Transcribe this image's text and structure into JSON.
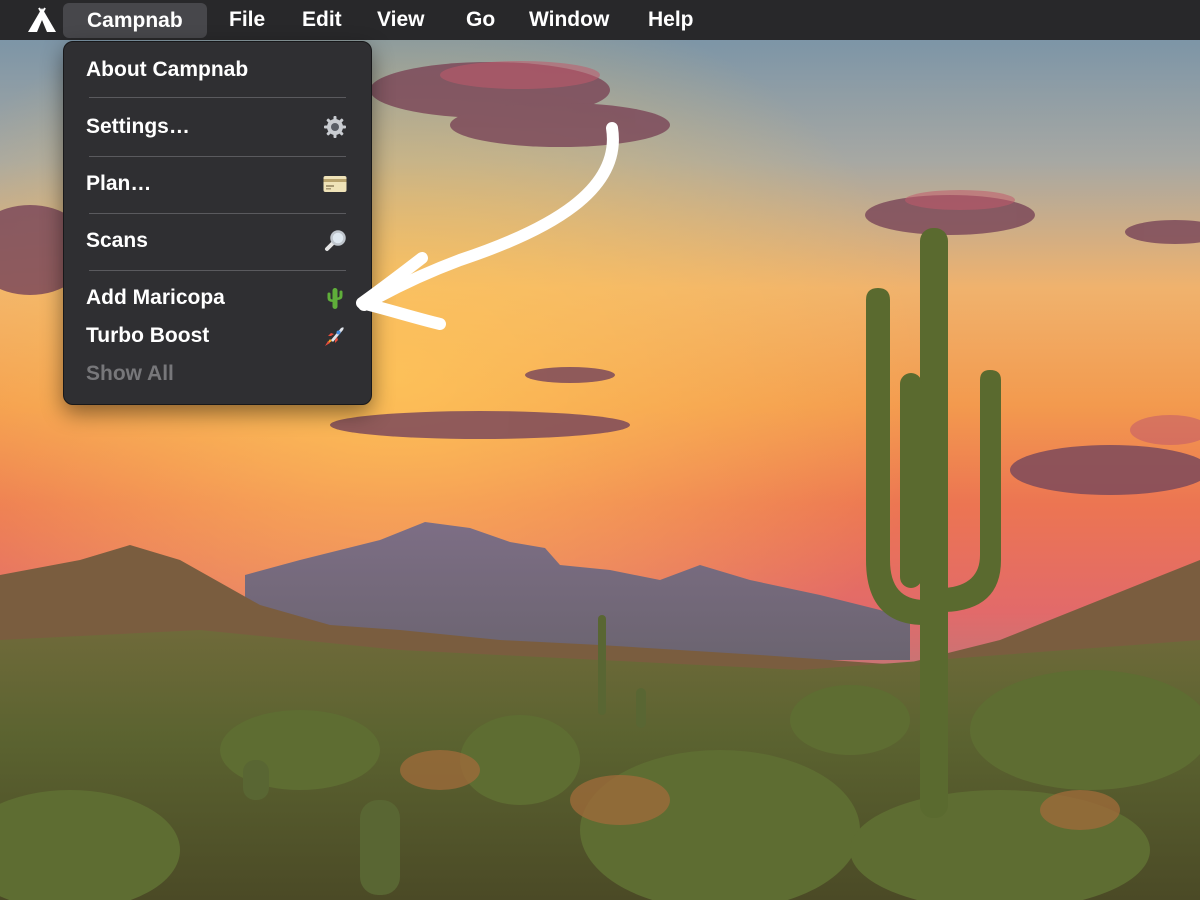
{
  "app": {
    "name": "Campnab"
  },
  "menubar": {
    "logo_icon": "tent-icon",
    "items": [
      {
        "label": "Campnab",
        "active": true
      },
      {
        "label": "File"
      },
      {
        "label": "Edit"
      },
      {
        "label": "View"
      },
      {
        "label": "Go"
      },
      {
        "label": "Window"
      },
      {
        "label": "Help"
      }
    ]
  },
  "dropdown": {
    "items": [
      {
        "label": "About Campnab",
        "icon": null,
        "enabled": true
      },
      {
        "label": "Settings…",
        "icon": "gear-icon",
        "enabled": true
      },
      {
        "label": "Plan…",
        "icon": "credit-card-icon",
        "enabled": true
      },
      {
        "label": "Scans",
        "icon": "magnifying-glass-icon",
        "enabled": true
      },
      {
        "label": "Add Maricopa",
        "icon": "cactus-icon",
        "enabled": true
      },
      {
        "label": "Turbo Boost",
        "icon": "rocket-icon",
        "enabled": true
      },
      {
        "label": "Show All",
        "icon": null,
        "enabled": false
      }
    ]
  },
  "annotation": {
    "icon": "hand-drawn-arrow-icon",
    "color": "#ffffff"
  },
  "colors": {
    "menubar_bg": "#28282a",
    "menu_bg": "#2f2f32",
    "active_item_bg": "#47474b",
    "disabled_text": "#77777a",
    "separator": "#5a5a5e"
  }
}
